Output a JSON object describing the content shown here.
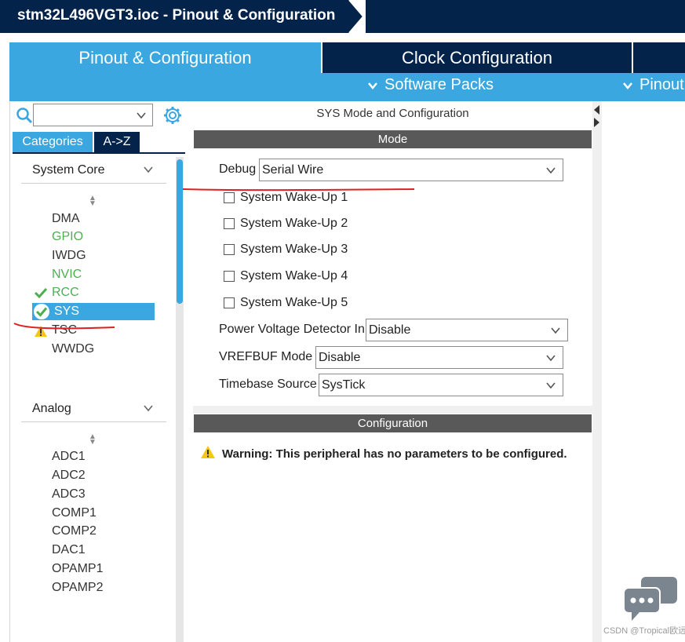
{
  "window": {
    "title": "stm32L496VGT3.ioc - Pinout & Configuration"
  },
  "tabs": {
    "pinout": "Pinout & Configuration",
    "clock": "Clock Configuration"
  },
  "subbar": {
    "software_packs": "Software Packs",
    "pinout": "Pinout"
  },
  "sidebar": {
    "search": {
      "value": "",
      "placeholder": ""
    },
    "view_buttons": {
      "categories": "Categories",
      "az": "A->Z"
    },
    "groups": [
      {
        "label": "System Core",
        "items": [
          {
            "label": "DMA",
            "status": "none"
          },
          {
            "label": "GPIO",
            "status": "configured"
          },
          {
            "label": "IWDG",
            "status": "none"
          },
          {
            "label": "NVIC",
            "status": "configured"
          },
          {
            "label": "RCC",
            "status": "ok"
          },
          {
            "label": "SYS",
            "status": "selected-ok"
          },
          {
            "label": "TSC",
            "status": "warning"
          },
          {
            "label": "WWDG",
            "status": "none"
          }
        ]
      },
      {
        "label": "Analog",
        "items": [
          {
            "label": "ADC1"
          },
          {
            "label": "ADC2"
          },
          {
            "label": "ADC3"
          },
          {
            "label": "COMP1"
          },
          {
            "label": "COMP2"
          },
          {
            "label": "DAC1"
          },
          {
            "label": "OPAMP1"
          },
          {
            "label": "OPAMP2"
          }
        ]
      }
    ]
  },
  "main": {
    "title": "SYS Mode and Configuration",
    "mode_header": "Mode",
    "debug": {
      "label": "Debug",
      "value": "Serial Wire"
    },
    "wakeups": [
      {
        "label": "System Wake-Up 1",
        "checked": false
      },
      {
        "label": "System Wake-Up 2",
        "checked": false
      },
      {
        "label": "System Wake-Up 3",
        "checked": false
      },
      {
        "label": "System Wake-Up 4",
        "checked": false
      },
      {
        "label": "System Wake-Up 5",
        "checked": false
      }
    ],
    "pvd": {
      "label": "Power Voltage Detector In",
      "value": "Disable"
    },
    "vrefbuf": {
      "label": "VREFBUF Mode",
      "value": "Disable"
    },
    "timebase": {
      "label": "Timebase Source",
      "value": "SysTick"
    },
    "config_header": "Configuration",
    "warning": {
      "prefix": "Warning:",
      "text": "This peripheral has no parameters to be configured."
    }
  },
  "watermark": "CSDN @Tropical欧远",
  "colors": {
    "navy": "#03234b",
    "accent_blue": "#3aa7e0",
    "section_gray": "#595959",
    "ok_green": "#4caf50",
    "warning_yellow": "#f5c518",
    "annotation_red": "#e02020"
  }
}
